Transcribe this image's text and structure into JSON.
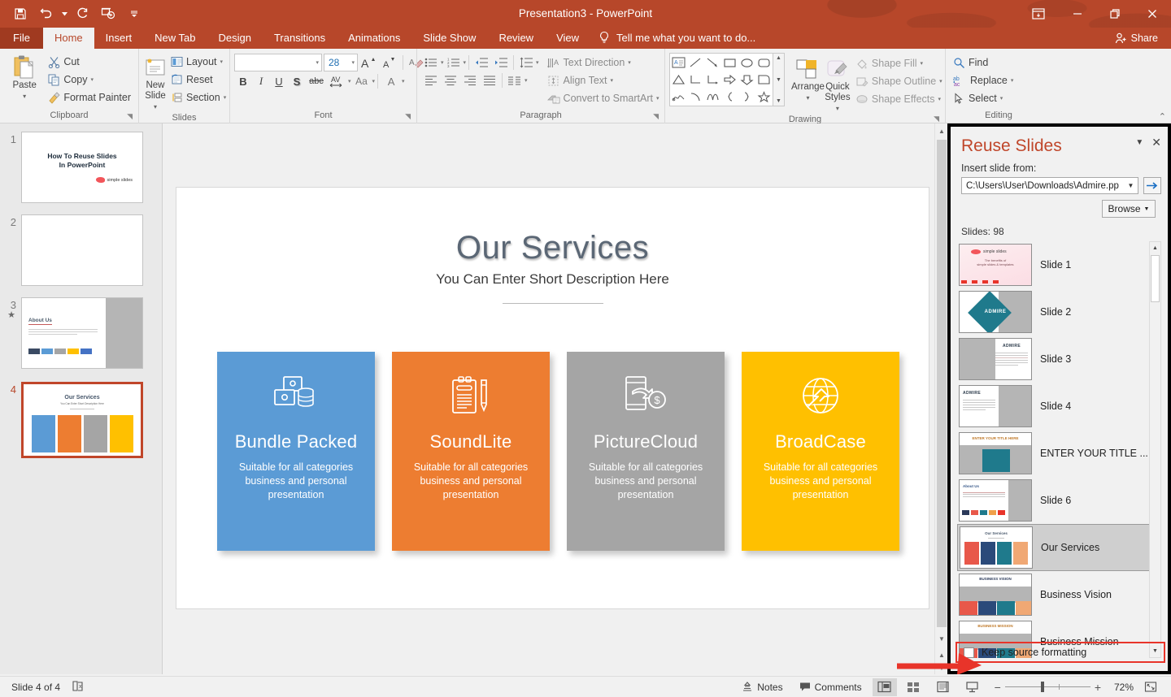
{
  "window": {
    "title": "Presentation3 - PowerPoint",
    "quick_access": [
      "save-icon",
      "undo-icon",
      "redo-icon",
      "start-slideshow-icon",
      "customize-qat-icon"
    ],
    "controls": [
      "ribbon-display-options-icon",
      "minimize-icon",
      "restore-icon",
      "close-icon"
    ],
    "share_label": "Share"
  },
  "tabs": [
    {
      "label": "File",
      "active": false
    },
    {
      "label": "Home",
      "active": true
    },
    {
      "label": "Insert",
      "active": false
    },
    {
      "label": "New Tab",
      "active": false
    },
    {
      "label": "Design",
      "active": false
    },
    {
      "label": "Transitions",
      "active": false
    },
    {
      "label": "Animations",
      "active": false
    },
    {
      "label": "Slide Show",
      "active": false
    },
    {
      "label": "Review",
      "active": false
    },
    {
      "label": "View",
      "active": false
    }
  ],
  "tellme": "Tell me what you want to do...",
  "ribbon": {
    "clipboard": {
      "label": "Clipboard",
      "paste": "Paste",
      "cut": "Cut",
      "copy": "Copy",
      "format_painter": "Format Painter"
    },
    "slides": {
      "label": "Slides",
      "new_slide": "New\nSlide",
      "new_slide_l1": "New",
      "new_slide_l2": "Slide",
      "layout": "Layout",
      "reset": "Reset",
      "section": "Section"
    },
    "font": {
      "label": "Font",
      "font_name": "",
      "font_size": "28",
      "grow_font": "A",
      "shrink_font": "A",
      "clear_formatting": "clear-formatting-icon",
      "bold": "B",
      "italic": "I",
      "underline": "U",
      "shadow": "S",
      "strikethrough": "abc",
      "character_spacing": "AV",
      "change_case": "Aa",
      "font_color": "A"
    },
    "paragraph": {
      "label": "Paragraph",
      "text_direction": "Text Direction",
      "align_text": "Align Text",
      "convert_to_smartart": "Convert to SmartArt"
    },
    "drawing": {
      "label": "Drawing",
      "arrange": "Arrange",
      "quick_styles_l1": "Quick",
      "quick_styles_l2": "Styles",
      "shape_fill": "Shape Fill",
      "shape_outline": "Shape Outline",
      "shape_effects": "Shape Effects"
    },
    "editing": {
      "label": "Editing",
      "find": "Find",
      "replace": "Replace",
      "select": "Select"
    }
  },
  "thumbnails": [
    {
      "num": "1",
      "title_l1": "How To Reuse Slides",
      "title_l2": "In PowerPoint",
      "logo": "simple slides",
      "kind": "title",
      "selected": false,
      "star": false
    },
    {
      "num": "2",
      "kind": "blank",
      "selected": false,
      "star": false
    },
    {
      "num": "3",
      "kind": "about",
      "heading": "About Us",
      "selected": false,
      "star": true
    },
    {
      "num": "4",
      "kind": "services",
      "heading": "Our Services",
      "selected": true,
      "star": false
    }
  ],
  "slide": {
    "title": "Our Services",
    "subtitle": "You Can Enter Short Description Here",
    "cards": [
      {
        "title": "Bundle Packed",
        "desc": "Suitable for all categories business and personal presentation",
        "color": "#5b9bd5",
        "icon": "money-stack-icon"
      },
      {
        "title": "SoundLite",
        "desc": "Suitable for all categories business and personal presentation",
        "color": "#ed7d31",
        "icon": "clipboard-pencil-icon"
      },
      {
        "title": "PictureCloud",
        "desc": "Suitable for all categories business and personal presentation",
        "color": "#a5a5a5",
        "icon": "mobile-payment-icon"
      },
      {
        "title": "BroadCase",
        "desc": "Suitable for all categories business and personal presentation",
        "color": "#ffc000",
        "icon": "globe-arrow-icon"
      }
    ]
  },
  "reuse_panel": {
    "title": "Reuse Slides",
    "insert_from_label": "Insert slide from:",
    "path_value": "C:\\Users\\User\\Downloads\\Admire.pp",
    "go_label": "→",
    "browse_label": "Browse",
    "slides_count": "Slides: 98",
    "items": [
      {
        "label": "Slide 1",
        "selected": false,
        "kind": "cover"
      },
      {
        "label": "Slide 2",
        "selected": false,
        "kind": "diamond"
      },
      {
        "label": "Slide 3",
        "selected": false,
        "kind": "text-right"
      },
      {
        "label": "Slide 4",
        "selected": false,
        "kind": "text-left"
      },
      {
        "label": "ENTER YOUR TITLE ...",
        "selected": false,
        "kind": "title-center"
      },
      {
        "label": "Slide 6",
        "selected": false,
        "kind": "about"
      },
      {
        "label": "Our Services",
        "selected": true,
        "kind": "four-cards"
      },
      {
        "label": "Business Vision",
        "selected": false,
        "kind": "four-cards-b"
      },
      {
        "label": "Business Mission",
        "selected": false,
        "kind": "four-cards-c"
      }
    ],
    "keep_source_formatting": "Keep source formatting",
    "keep_source_checked": false
  },
  "statusbar": {
    "slide_indicator": "Slide 4 of 4",
    "accessibility_icon": "accessibility-checker-icon",
    "notes": "Notes",
    "comments": "Comments",
    "views": [
      "normal-view-icon",
      "slide-sorter-icon",
      "reading-view-icon",
      "slideshow-view-icon"
    ],
    "zoom_out": "−",
    "zoom_in": "+",
    "zoom_value": "72%",
    "fit_slide": "fit-to-window-icon"
  },
  "annotation": {
    "arrow_color": "#e8342a",
    "highlight_color": "#e8342a"
  }
}
